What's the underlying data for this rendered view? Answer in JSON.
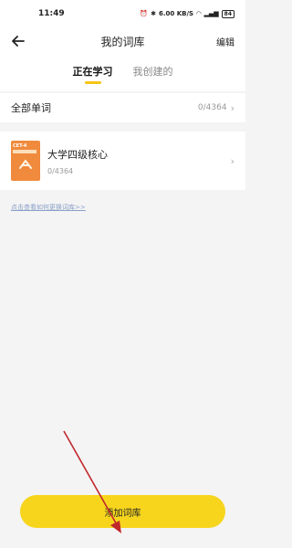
{
  "status_bar": {
    "time": "11:49",
    "speed": "6.00 KB/S",
    "battery": "84"
  },
  "header": {
    "title": "我的词库",
    "edit_label": "编辑"
  },
  "tabs": [
    {
      "label": "正在学习",
      "active": true
    },
    {
      "label": "我创建的",
      "active": false
    }
  ],
  "all_words": {
    "label": "全部单词",
    "count": "0/4364"
  },
  "book": {
    "cover_tag": "CET-4",
    "name": "大学四级核心",
    "progress": "0/4364"
  },
  "help_link": "点击查看如何更换词库>>",
  "add_button": "添加词库",
  "colors": {
    "accent": "#f7d51d",
    "cover": "#f08a3c",
    "annotation_arrow": "#c0282d"
  }
}
